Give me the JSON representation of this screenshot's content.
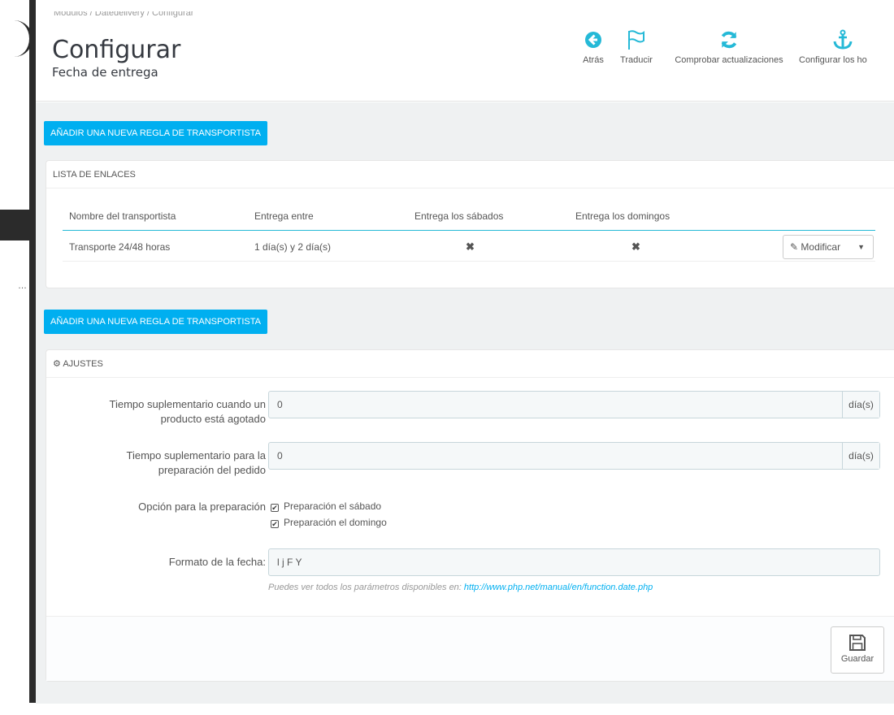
{
  "breadcrumb": "Módulos / Datedelivery / Configurar",
  "header": {
    "title": "Configurar",
    "subtitle": "Fecha de entrega"
  },
  "toolbar": {
    "back": "Atrás",
    "translate": "Traducir",
    "check_updates": "Comprobar actualizaciones",
    "configure_hooks": "Configurar los ho"
  },
  "add_rule_label": "Añadir una nueva regla de transportista",
  "links_panel": {
    "heading": "Lista de enlaces",
    "columns": [
      "Nombre del transportista",
      "Entrega entre",
      "Entrega los sábados",
      "Entrega los domingos"
    ],
    "rows": [
      {
        "carrier": "Transporte 24/48 horas",
        "delivery_between": "1 día(s) y 2 día(s)",
        "saturday": "✖",
        "sunday": "✖",
        "action": "Modificar"
      }
    ]
  },
  "settings_panel": {
    "heading": "Ajustes",
    "out_of_stock_label": "Tiempo suplementario cuando un producto está agotado",
    "out_of_stock_value": "0",
    "preparation_label": "Tiempo suplementario para la preparación del pedido",
    "preparation_value": "0",
    "unit": "día(s)",
    "prep_option_label": "Opción para la preparación",
    "prep_saturday": "Preparación el sábado",
    "prep_sunday": "Preparación el domingo",
    "date_format_label": "Formato de la fecha:",
    "date_format_value": "l j F Y",
    "help_text": "Puedes ver todos los parámetros disponibles en: ",
    "help_link": "http://www.php.net/manual/en/function.date.php",
    "save_label": "Guardar"
  },
  "colors": {
    "accent": "#00aff0",
    "cross": "#e08080",
    "background": "#eff1f2"
  }
}
